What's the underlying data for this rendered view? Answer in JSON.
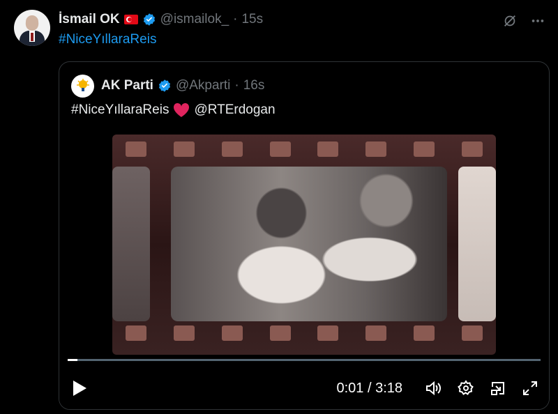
{
  "tweet": {
    "author_name": "İsmail OK",
    "handle": "@ismailok_",
    "separator": "·",
    "time": "15s",
    "text": "#NiceYıllaraReis"
  },
  "quoted": {
    "author_name": "AK Parti",
    "handle": "@Akparti",
    "separator": "·",
    "time": "16s",
    "hashtag": "#NiceYıllaraReis",
    "mention": "@RTErdogan"
  },
  "video": {
    "timecode": "0:01 / 3:18",
    "progress": 0.005
  },
  "colors": {
    "background": "#000000",
    "link": "#1d9bf0",
    "muted": "#71767b",
    "verified": "#1d9bf0",
    "heart": "#e0245e"
  },
  "icons": [
    "grok-icon",
    "more-icon",
    "verified-icon",
    "play-icon",
    "volume-icon",
    "settings-icon",
    "pip-icon",
    "fullscreen-icon",
    "heart-icon"
  ]
}
